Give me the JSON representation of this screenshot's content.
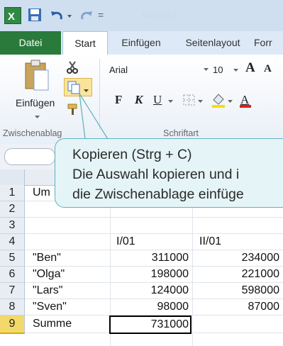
{
  "qat": {
    "separator": "=",
    "title": "Mappe1"
  },
  "tabs": [
    "Datei",
    "Start",
    "Einfügen",
    "Seitenlayout",
    "Forr"
  ],
  "ribbon": {
    "paste_label": "Einfügen",
    "font_name": "Arial",
    "font_size": "10",
    "bold": "F",
    "italic": "K",
    "underline": "U",
    "grow_font": "A",
    "group_clipboard": "Zwischenablag",
    "group_font": "Schriftart"
  },
  "tooltip": {
    "title": "Kopieren (Strg + C)",
    "line1": "Die Auswahl kopieren und i",
    "line2": "die Zwischenablage einfüge"
  },
  "sheet": {
    "row_numbers": [
      "1",
      "2",
      "3",
      "4",
      "5",
      "6",
      "7",
      "8",
      "9"
    ],
    "a1": "Um",
    "headers": [
      "I/01",
      "II/01"
    ],
    "rows": [
      {
        "name": "\"Ben\"",
        "v1": "311000",
        "v2": "234000"
      },
      {
        "name": "\"Olga\"",
        "v1": "198000",
        "v2": "221000"
      },
      {
        "name": "\"Lars\"",
        "v1": "124000",
        "v2": "598000"
      },
      {
        "name": "\"Sven\"",
        "v1": "98000",
        "v2": "87000"
      }
    ],
    "total_label": "Summe",
    "total_value": "731000"
  },
  "colors": {
    "accent_green": "#2a7a3c",
    "tooltip_bg": "#e5f4f6",
    "tooltip_border": "#5fb2bd",
    "selected_row": "#f3d96a"
  }
}
